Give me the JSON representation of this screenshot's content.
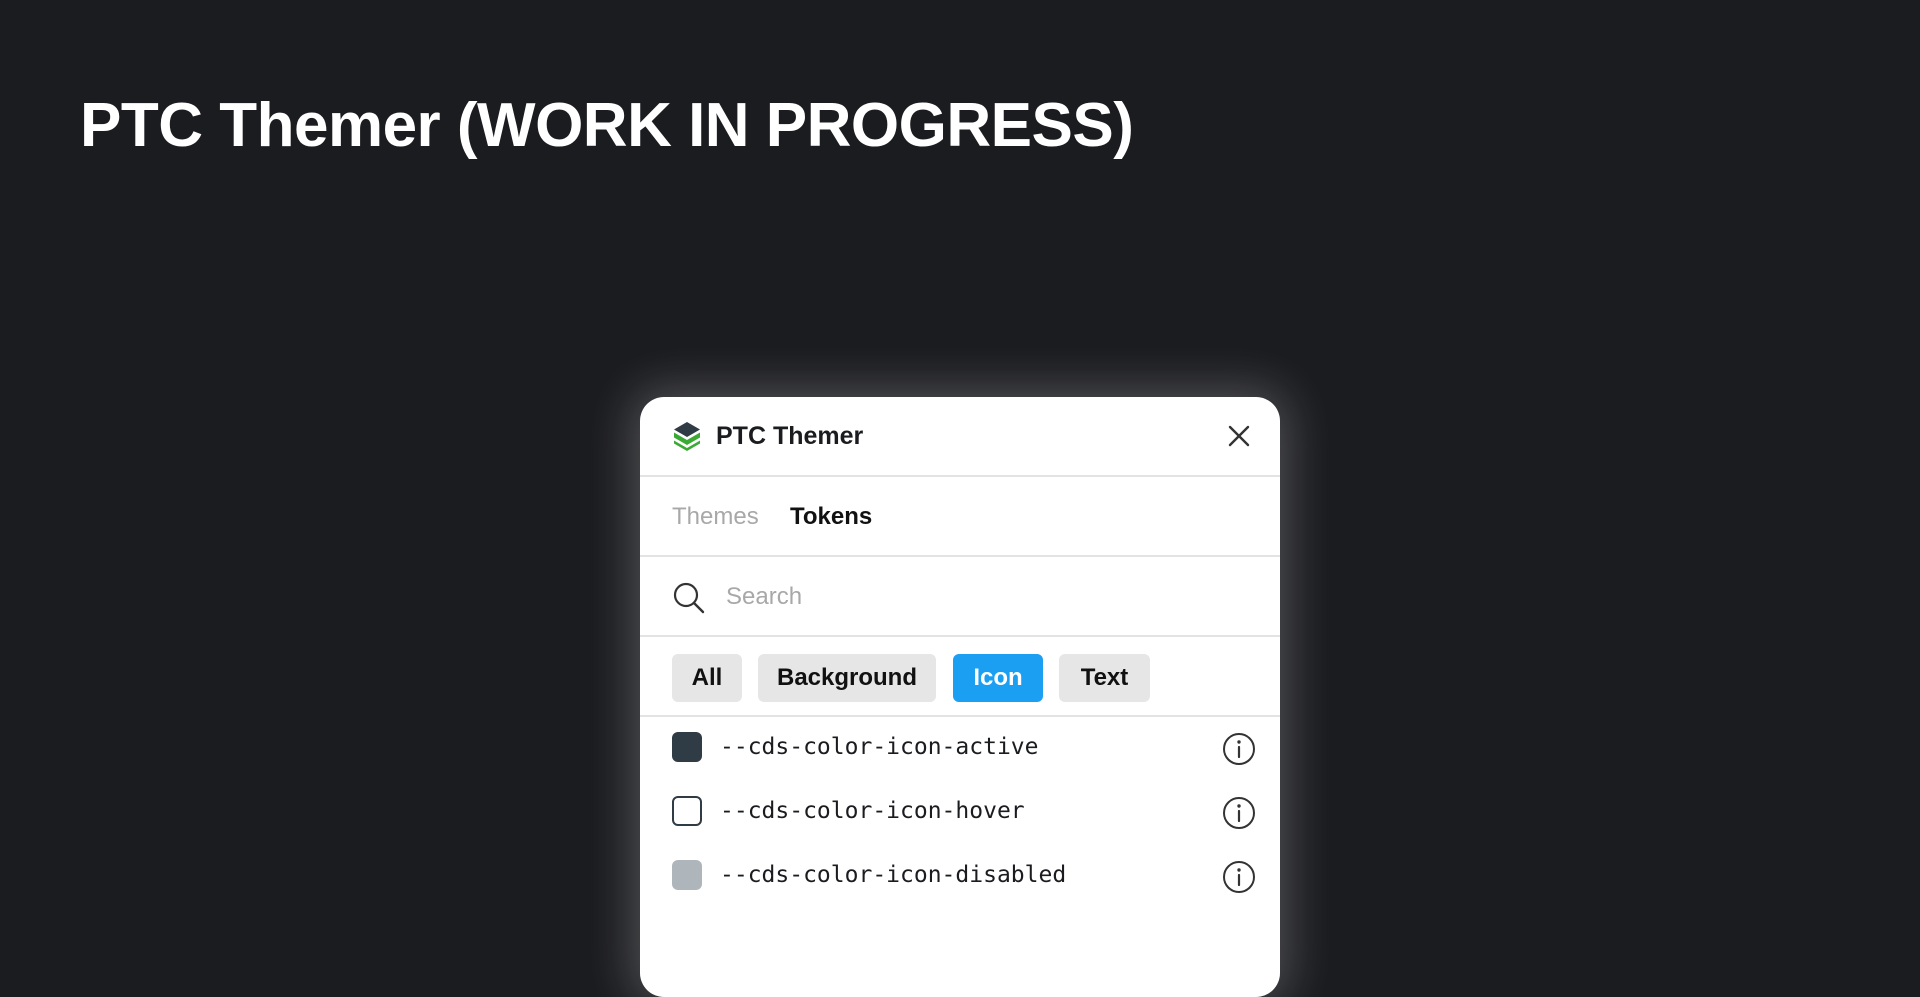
{
  "page": {
    "title": "PTC Themer (WORK IN PROGRESS)"
  },
  "panel": {
    "title": "PTC Themer",
    "logo_icon": "ptc-logo-icon",
    "close_icon": "close-icon"
  },
  "tabs": [
    {
      "label": "Themes",
      "active": false
    },
    {
      "label": "Tokens",
      "active": true
    }
  ],
  "search": {
    "placeholder": "Search",
    "value": "",
    "icon": "search-icon"
  },
  "filters": [
    {
      "label": "All",
      "active": false
    },
    {
      "label": "Background",
      "active": false
    },
    {
      "label": "Icon",
      "active": true
    },
    {
      "label": "Text",
      "active": false
    }
  ],
  "tokens": [
    {
      "name": "--cds-color-icon-active",
      "swatch_color": "#2f3b45",
      "info_icon": "info-icon"
    },
    {
      "name": "--cds-color-icon-hover",
      "swatch_color": "#ffffff",
      "info_icon": "info-icon"
    },
    {
      "name": "--cds-color-icon-disabled",
      "swatch_color": "#aeb6bb",
      "info_icon": "info-icon"
    }
  ],
  "colors": {
    "page_background": "#1b1c20",
    "accent": "#1a9ff2",
    "chip_background": "#e6e6e6",
    "logo_green": "#3aaa35",
    "logo_dark": "#2f3b45"
  }
}
